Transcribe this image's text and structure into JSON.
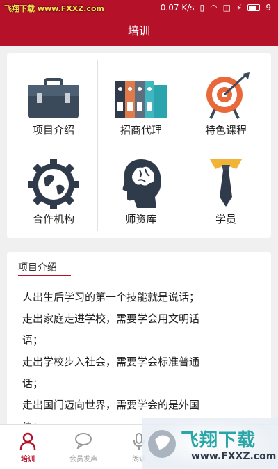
{
  "status_bar": {
    "watermark": "飞翔下载 www.FXXZ.com",
    "network_speed": "0.07 K/s",
    "battery": "9"
  },
  "header": {
    "title": "培训"
  },
  "grid": [
    {
      "label": "项目介绍",
      "icon": "briefcase-icon"
    },
    {
      "label": "招商代理",
      "icon": "binders-icon"
    },
    {
      "label": "特色课程",
      "icon": "target-icon"
    },
    {
      "label": "合作机构",
      "icon": "globe-gear-icon"
    },
    {
      "label": "师资库",
      "icon": "brain-head-icon"
    },
    {
      "label": "学员",
      "icon": "shirt-tie-icon"
    }
  ],
  "intro": {
    "title": "项目介绍",
    "text": "人出生后学习的第一个技能就是说话；\n走出家庭走进学校，需要学会用文明话\n语；\n走出学校步入社会，需要学会标准普通\n话；\n走出国门迈向世界，需要学会的是外国\n语；"
  },
  "tabs": [
    {
      "label": "培训",
      "icon": "person-icon",
      "active": true
    },
    {
      "label": "会员发声",
      "icon": "chat-bubble-icon",
      "active": false
    },
    {
      "label": "朗读",
      "icon": "microphone-icon",
      "active": false
    }
  ],
  "watermark_logo": {
    "text": "飞翔下载",
    "url": "www.FXXZ.com"
  },
  "colors": {
    "brand": "#b5122a",
    "background": "#f0f0f0"
  }
}
